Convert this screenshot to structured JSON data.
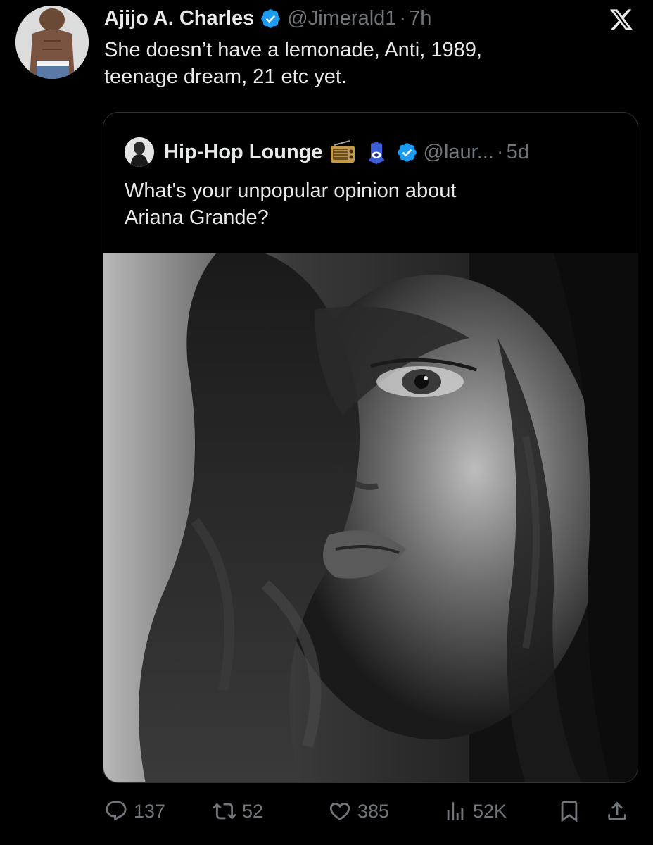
{
  "tweet": {
    "author_name": "Ajijo A. Charles",
    "author_handle": "@Jimerald1",
    "separator": "·",
    "time": "7h",
    "text_line1": "She doesn’t have a lemonade, Anti, 1989,",
    "text_line2": "teenage dream, 21 etc yet."
  },
  "quote": {
    "author_name": "Hip-Hop Lounge",
    "author_handle": "@laur...",
    "separator": "·",
    "time": "5d",
    "text_line1": "What's your unpopular opinion about",
    "text_line2": "Ariana Grande?",
    "emojis": [
      "radio-emoji",
      "hamsa-emoji"
    ]
  },
  "actions": {
    "replies": "137",
    "reposts": "52",
    "likes": "385",
    "views": "52K"
  },
  "icons": {
    "verified": "verified-badge-icon",
    "logo": "x-logo-icon",
    "reply": "reply-icon",
    "repost": "repost-icon",
    "like": "heart-icon",
    "views": "views-icon",
    "bookmark": "bookmark-icon",
    "share": "share-icon"
  },
  "colors": {
    "background": "#000000",
    "text": "#e7e9ea",
    "muted": "#71767b",
    "verified": "#1d9bf0",
    "border": "#2f3336"
  }
}
